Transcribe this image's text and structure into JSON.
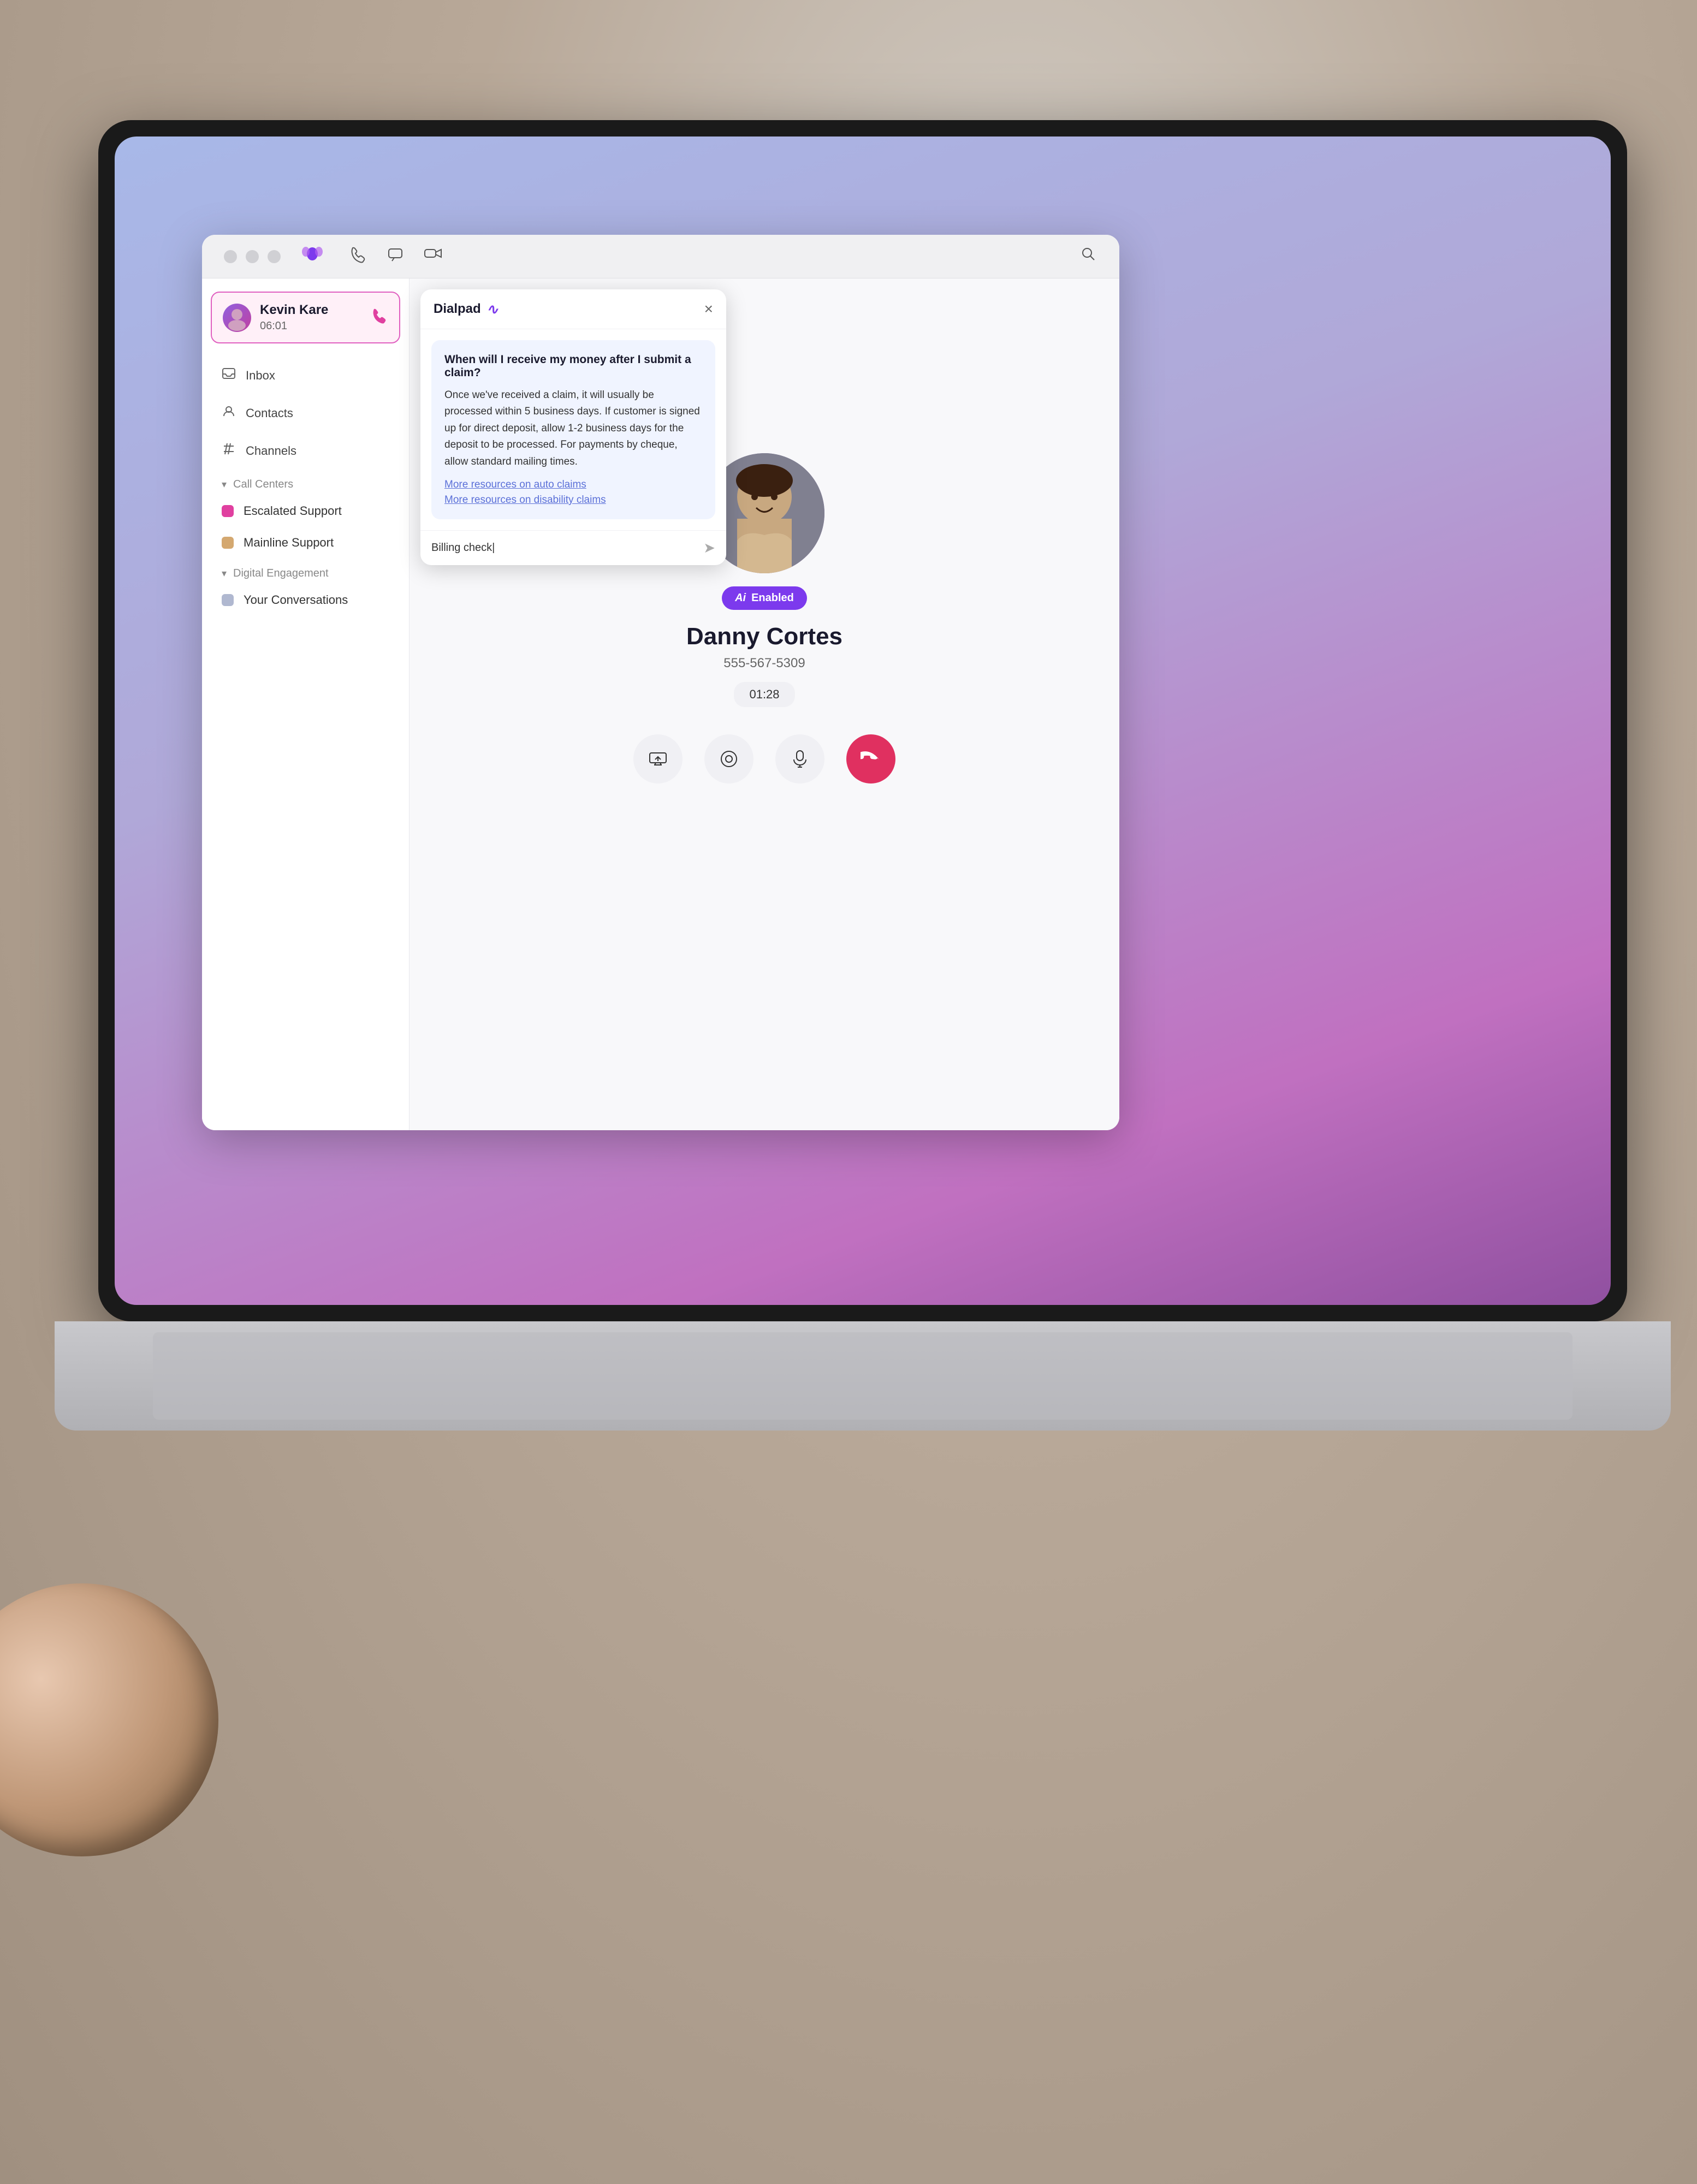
{
  "background": {
    "color": "#c8bfb0"
  },
  "titlebar": {
    "icons": {
      "phone_label": "📞",
      "chat_label": "💬",
      "video_label": "📹",
      "search_label": "🔍"
    },
    "logo": "●●"
  },
  "sidebar": {
    "active_call": {
      "caller_name": "Kevin Kare",
      "timer": "06:01",
      "phone_icon": "📞"
    },
    "nav_items": [
      {
        "id": "inbox",
        "label": "Inbox",
        "icon": "inbox"
      },
      {
        "id": "contacts",
        "label": "Contacts",
        "icon": "contact"
      },
      {
        "id": "channels",
        "label": "Channels",
        "icon": "hash"
      }
    ],
    "call_centers_header": "Call Centers",
    "call_centers": [
      {
        "id": "escalated",
        "label": "Escalated Support",
        "color": "#e040a0"
      },
      {
        "id": "mainline",
        "label": "Mainline Support",
        "color": "#d4a870"
      }
    ],
    "digital_engagement_header": "Digital Engagement",
    "digital_engagement": [
      {
        "id": "conversations",
        "label": "Your Conversations",
        "color": "#b0b8d0"
      }
    ]
  },
  "ai_popup": {
    "title": "Dialpad",
    "ai_icon": "Ai",
    "close_icon": "×",
    "question": "When will I receive my money after I submit a claim?",
    "answer": "Once we've received a claim, it will usually be processed within 5 business days. If customer is signed up for direct deposit, allow 1-2 business days for the deposit to be processed. For payments by cheque, allow standard mailing times.",
    "links": [
      "More resources on auto claims",
      "More resources on disability claims"
    ],
    "input_placeholder": "Billing check|",
    "send_icon": "➤"
  },
  "contact_panel": {
    "name": "Danny Cortes",
    "phone": "555-567-5309",
    "call_duration": "01:28",
    "ai_badge_label": "Enabled",
    "ai_badge_icon": "Ai",
    "actions": {
      "screen_share_icon": "⊞",
      "record_icon": "⊙",
      "mute_icon": "🎤",
      "end_call_icon": "📞"
    }
  }
}
